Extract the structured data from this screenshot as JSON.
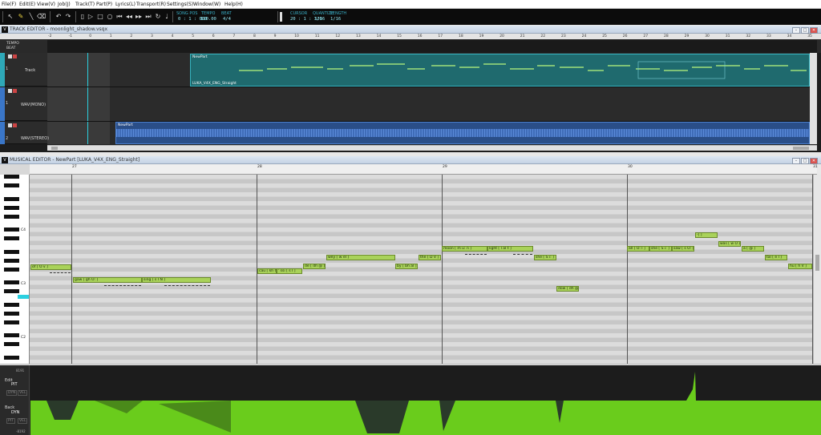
{
  "menubar": {
    "items": [
      "File(F)",
      "Edit(E)",
      "View(V)",
      "Job(J)",
      "Track(T)",
      "Part(P)",
      "Lyrics(L)",
      "Transport(R)",
      "Settings(S)",
      "Window(W)",
      "Help(H)"
    ]
  },
  "toolbar": {
    "song_pos_label": "SONG POS",
    "song_pos": "0 : 1 : 000",
    "tempo_label": "TEMPO",
    "tempo": "120.00",
    "beat_label": "BEAT",
    "beat": "4/4",
    "cursor_label": "CURSOR",
    "cursor": "20 : 1 : 320",
    "quantize_label": "QUANTIZE",
    "quantize": "1/16",
    "length_label": "LENGTH",
    "length": "1/16",
    "icons": [
      "pointer-icon",
      "pencil-icon",
      "line-icon",
      "eraser-icon",
      "rewind-icon",
      "play-icon",
      "stop-icon",
      "record-icon",
      "forward-icon",
      "loop-icon",
      "metronome-icon"
    ]
  },
  "track_editor": {
    "title": "TRACK EDITOR - moonlight_shadow.vsqx",
    "tempo_label": "TEMPO",
    "beat_label": "BEAT",
    "ruler": [
      "-2",
      "-1",
      "0",
      "1",
      "2",
      "3",
      "4",
      "5",
      "6",
      "7",
      "8",
      "9",
      "10",
      "11",
      "12",
      "13",
      "14",
      "15",
      "16",
      "17",
      "18",
      "19",
      "20",
      "21",
      "22",
      "23",
      "24",
      "25",
      "26",
      "27",
      "28",
      "29",
      "30",
      "31",
      "32",
      "33",
      "34",
      "35"
    ],
    "tracks": [
      {
        "num": "1",
        "name": "Track",
        "color": "#2ea8b8",
        "part_name": "NewPart",
        "part_sub": "LUKA_V4X_ENG_Straight"
      },
      {
        "num": "1",
        "name": "WAV(MONO)",
        "color": "#3a76c8"
      },
      {
        "num": "2",
        "name": "WAV(STEREO)",
        "color": "#3a76c8",
        "part_name": "NewPart"
      }
    ]
  },
  "musical_editor": {
    "title": "MUSICAL EDITOR - NewPart [LUKA_V4X_ENG_Straight]",
    "bars": [
      "27",
      "28",
      "29",
      "30",
      "31"
    ],
    "key_labels": [
      "C4",
      "C3",
      "C2"
    ],
    "notes": [
      {
        "lyric": "of [ O v ]"
      },
      {
        "lyric": "gaw [ gh O: ]"
      },
      {
        "lyric": "sing [ s I N ]"
      },
      {
        "lyric": "cau [ kh O: ]"
      },
      {
        "lyric": "' ssi [ s I ]"
      },
      {
        "lyric": "de [ dh @ ]"
      },
      {
        "lyric": "wey [ w eI ]"
      },
      {
        "lyric": "by [ bh aI ]"
      },
      {
        "lyric": "the [ D V ]"
      },
      {
        "lyric": "moon [ m u: n ]"
      },
      {
        "lyric": "light [ l aI t ]"
      },
      {
        "lyric": "she [ S i: ]"
      },
      {
        "lyric": "dow [ dh @ ]"
      },
      {
        "lyric": "all [ O: l ]"
      },
      {
        "lyric": "she [ S i: ]"
      },
      {
        "lyric": "saw [ s O: ]"
      },
      {
        "lyric": "-[ ]"
      },
      {
        "lyric": "was [ w O z ]"
      },
      {
        "lyric": "a [ @ ]"
      },
      {
        "lyric": "tal [ e l ]"
      },
      {
        "lyric": "hu [ h V ]"
      }
    ]
  },
  "param_panel": {
    "edit_label": "Edit",
    "edit_param": "PIT",
    "back_label": "Back",
    "back_param": "DYN",
    "buttons": [
      "DYN",
      "VEL",
      "PIT",
      "VEL"
    ],
    "scale_top": "8191",
    "scale_bottom": "-8192"
  },
  "colors": {
    "accent": "#2ea8b8",
    "note": "#a9d25a",
    "param_fill": "#6acc1c"
  }
}
